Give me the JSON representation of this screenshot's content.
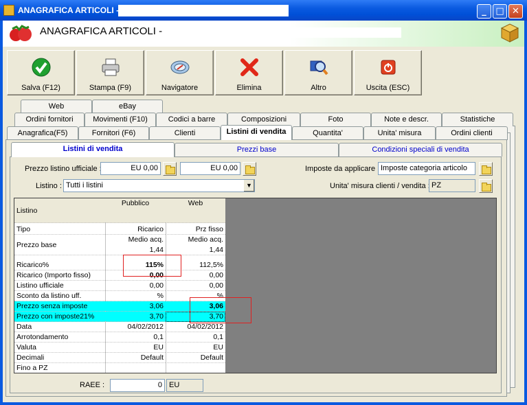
{
  "window": {
    "title": "ANAGRAFICA ARTICOLI -",
    "header_title": "ANAGRAFICA ARTICOLI -",
    "minimize_glyph": "_",
    "maximize_glyph": "□",
    "close_glyph": "✕"
  },
  "toolbar": {
    "save": "Salva (F12)",
    "print": "Stampa (F9)",
    "navigator": "Navigatore",
    "delete": "Elimina",
    "other": "Altro",
    "exit": "Uscita (ESC)"
  },
  "tabs": {
    "row3": [
      "Web",
      "eBay"
    ],
    "row2": [
      "Ordini fornitori",
      "Movimenti (F10)",
      "Codici a barre",
      "Composizioni",
      "Foto",
      "Note e descr.",
      "Statistiche"
    ],
    "row1": [
      "Anagrafica(F5)",
      "Fornitori (F6)",
      "Clienti",
      "Listini di vendita",
      "Quantita'",
      "Unita' misura",
      "Ordini clienti"
    ]
  },
  "subtabs": [
    "Listini di vendita",
    "Prezzi base",
    "Condizioni speciali di vendita"
  ],
  "form": {
    "prezzo_listino_label": "Prezzo listino ufficiale :",
    "prezzo_listino_value1": "EU 0,00",
    "prezzo_listino_value2": "EU 0,00",
    "imposte_label": "Imposte da applicare :",
    "imposte_value": "Imposte categoria articolo",
    "listino_label": "Listino :",
    "listino_value": "Tutti i listini",
    "um_label": "Unita' misura clienti / vendita :",
    "um_value": "PZ",
    "raee_label": "RAEE :",
    "raee_value": "0",
    "raee_unit": "EU"
  },
  "grid": {
    "header_label": "Listino",
    "columns": [
      "Pubblico",
      "Web"
    ],
    "rows": [
      {
        "label": "Tipo",
        "pubblico": "Ricarico",
        "web": "Prz fisso"
      },
      {
        "label": "Prezzo base",
        "pubblico": "Medio acq.",
        "web": "Medio acq.",
        "pubblico2": "1,44",
        "web2": "1,44"
      },
      {
        "label": "Ricarico%",
        "pubblico": "115%",
        "web": "112,5%"
      },
      {
        "label": "Ricarico (Importo fisso)",
        "pubblico": "0,00",
        "web": "0,00"
      },
      {
        "label": "Listino ufficiale",
        "pubblico": "0,00",
        "web": "0,00"
      },
      {
        "label": "Sconto da listino uff.",
        "pubblico": "%",
        "web": "%"
      },
      {
        "label": "Prezzo senza imposte",
        "pubblico": "3,06",
        "web": "3,06"
      },
      {
        "label": "Prezzo con imposte21%",
        "pubblico": "3,70",
        "web": "3,70"
      },
      {
        "label": "Data",
        "pubblico": "04/02/2012",
        "web": "04/02/2012"
      },
      {
        "label": "Arrotondamento",
        "pubblico": "0,1",
        "web": "0,1"
      },
      {
        "label": "Valuta",
        "pubblico": "EU",
        "web": "EU"
      },
      {
        "label": "Decimali",
        "pubblico": "Default",
        "web": "Default"
      },
      {
        "label": "Fino a PZ",
        "pubblico": "",
        "web": ""
      }
    ]
  },
  "colors": {
    "highlight": "#00FFFF",
    "annotation": "#E02020",
    "titlebar": "#0A5AE0"
  }
}
